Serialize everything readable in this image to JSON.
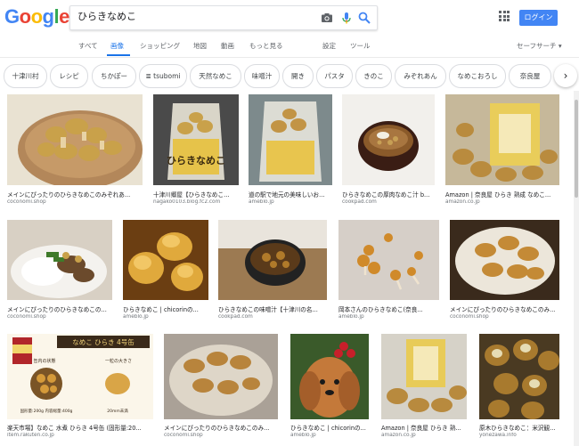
{
  "search": {
    "query": "ひらきなめこ"
  },
  "logo": {
    "letters": [
      "G",
      "o",
      "o",
      "g",
      "l",
      "e"
    ],
    "colors": [
      "#4285f4",
      "#ea4335",
      "#fbbc05",
      "#4285f4",
      "#34a853",
      "#ea4335"
    ]
  },
  "header": {
    "login_label": "ログイン"
  },
  "tabs": [
    {
      "label": "すべて"
    },
    {
      "label": "画像"
    },
    {
      "label": "ショッピング"
    },
    {
      "label": "地図"
    },
    {
      "label": "動画"
    },
    {
      "label": "もっと見る"
    },
    {
      "label": "設定"
    },
    {
      "label": "ツール"
    },
    {
      "label": "セーフサーチ ▾"
    }
  ],
  "chips": [
    {
      "label": "十津川村"
    },
    {
      "label": "レシピ"
    },
    {
      "label": "ちかぽー"
    },
    {
      "label": "≣ tsubomi"
    },
    {
      "label": "天然なめこ"
    },
    {
      "label": "味噌汁"
    },
    {
      "label": "開き"
    },
    {
      "label": "パスタ"
    },
    {
      "label": "きのこ"
    },
    {
      "label": "みぞれあん"
    },
    {
      "label": "なめこおろし"
    },
    {
      "label": "奈良屋"
    }
  ],
  "chip_next_icon": "chevron-right-icon",
  "results": [
    {
      "caption": "メインにぴったりのひらきなめこのみぞれあ...",
      "source": "coconomi.shop"
    },
    {
      "caption": "十津川郷屋【ひらきなめこ...",
      "source": "nagako0103.blog.fc2.com"
    },
    {
      "caption": "道の駅で地元の美味しいお...",
      "source": "ameblo.jp"
    },
    {
      "caption": "ひらきなめこの厚肉なめこ汁 b...",
      "source": "cookpad.com"
    },
    {
      "caption": "Amazon | 奈良屋 ひらき 熟成 なめこ...",
      "source": "amazon.co.jp"
    },
    {
      "caption": "メインにぴったりのひらきなめこの...",
      "source": "coconomi.shop"
    },
    {
      "caption": "ひらきなめこ | chicorinの...",
      "source": "ameblo.jp"
    },
    {
      "caption": "ひらきなめこの味噌汁【十津川の名...",
      "source": "cookpad.com"
    },
    {
      "caption": "岡本さんのひらきなめこ(奈良...",
      "source": "ameblo.jp"
    },
    {
      "caption": "メインにぴったりのひらきなめこのみ...",
      "source": "coconomi.shop"
    },
    {
      "caption": "楽天市場】なめこ 水煮 ひらき 4号缶 (固形量:20...",
      "source": "item.rakuten.co.jp"
    },
    {
      "caption": "メインにぴったりのひらきなめこのみ...",
      "source": "coconomi.shop"
    },
    {
      "caption": "ひらきなめこ | chicorinの...",
      "source": "ameblo.jp"
    },
    {
      "caption": "Amazon | 奈良屋 ひらき 熟...",
      "source": "amazon.co.jp"
    },
    {
      "caption": "原木ひらきなめこ：米沢観...",
      "source": "yonezawa.info"
    }
  ],
  "image_text": {
    "can_title": "なめこ ひらき 4号缶",
    "can_contents": "缶内の状態",
    "can_size": "一粒の大きさ",
    "can_weight": "固形量:200g 内容総量:400g",
    "can_scale": "20mm未満",
    "package_label": "ひらきなめこ"
  },
  "colors": {
    "accent": "#1a73e8",
    "login": "#4285f4",
    "caption": "#202124",
    "source": "#70757a"
  }
}
